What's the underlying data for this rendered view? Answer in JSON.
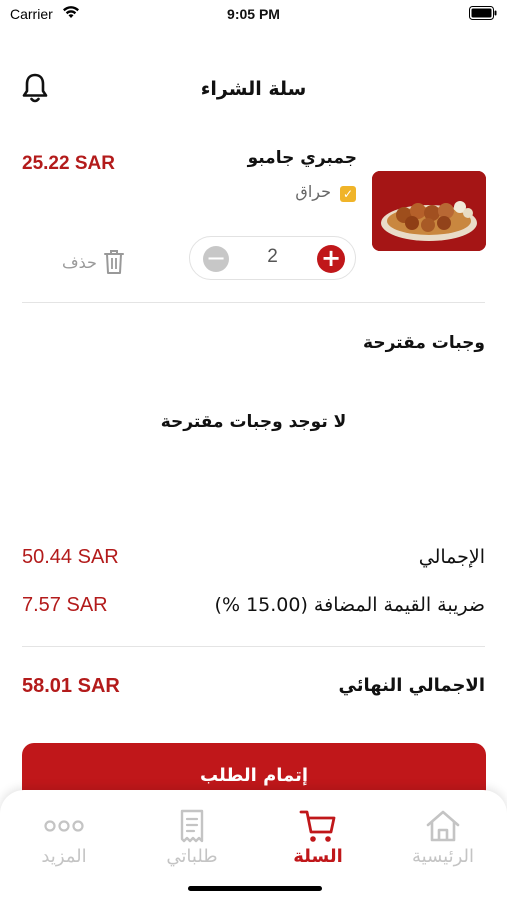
{
  "status_bar": {
    "carrier": "Carrier",
    "time": "9:05 PM"
  },
  "header": {
    "title": "سلة الشراء"
  },
  "cart_item": {
    "name": "جمبري جامبو",
    "price": "25.22 SAR",
    "option_label": "حراق",
    "option_checked": true,
    "quantity": "2",
    "delete_label": "حذف"
  },
  "suggested": {
    "title": "وجبات مقترحة",
    "empty_message": "لا توجد وجبات مقترحة"
  },
  "summary": {
    "subtotal_label": "الإجمالي",
    "subtotal_value": "50.44 SAR",
    "vat_label": "ضريبة القيمة المضافة (15.00 %)",
    "vat_value": "7.57 SAR",
    "total_label": "الاجمالي النهائي",
    "total_value": "58.01 SAR"
  },
  "checkout_button": "إتمام الطلب",
  "tabs": [
    {
      "label": "الرئيسية",
      "icon": "home-icon",
      "active": false
    },
    {
      "label": "السلة",
      "icon": "cart-icon",
      "active": true
    },
    {
      "label": "طلباتي",
      "icon": "receipt-icon",
      "active": false
    },
    {
      "label": "المزيد",
      "icon": "more-icon",
      "active": false
    }
  ],
  "colors": {
    "accent": "#c0171a",
    "price": "#b31b1b",
    "inactive": "#c4c4c4"
  }
}
